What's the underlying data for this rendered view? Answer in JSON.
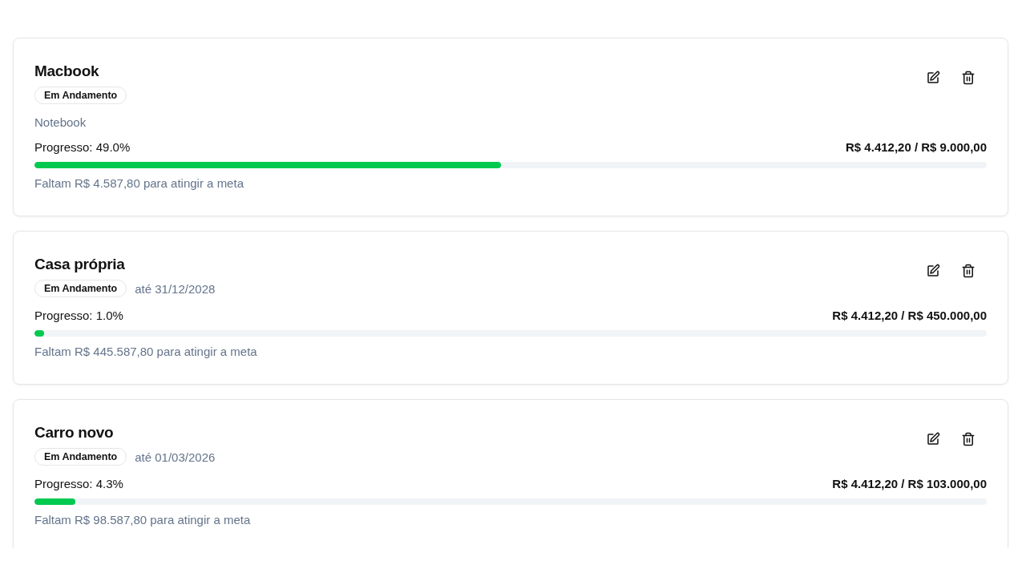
{
  "goals": [
    {
      "title": "Macbook",
      "status": "Em Andamento",
      "description": "Notebook",
      "progress_label": "Progresso: 49.0%",
      "amounts": "R$ 4.412,20 / R$ 9.000,00",
      "level": 0.49,
      "remaining": "Faltam R$ 4.587,80 para atingir a meta"
    },
    {
      "title": "Casa própria",
      "status": "Em Andamento",
      "deadline": "até 31/12/2028",
      "progress_label": "Progresso: 1.0%",
      "amounts": "R$ 4.412,20 / R$ 450.000,00",
      "level": 0.01,
      "remaining": "Faltam R$ 445.587,80 para atingir a meta"
    },
    {
      "title": "Carro novo",
      "status": "Em Andamento",
      "deadline": "até 01/03/2026",
      "progress_label": "Progresso: 4.3%",
      "amounts": "R$ 4.412,20 / R$ 103.000,00",
      "level": 0.043,
      "remaining": "Faltam R$ 98.587,80 para atingir a meta"
    }
  ]
}
